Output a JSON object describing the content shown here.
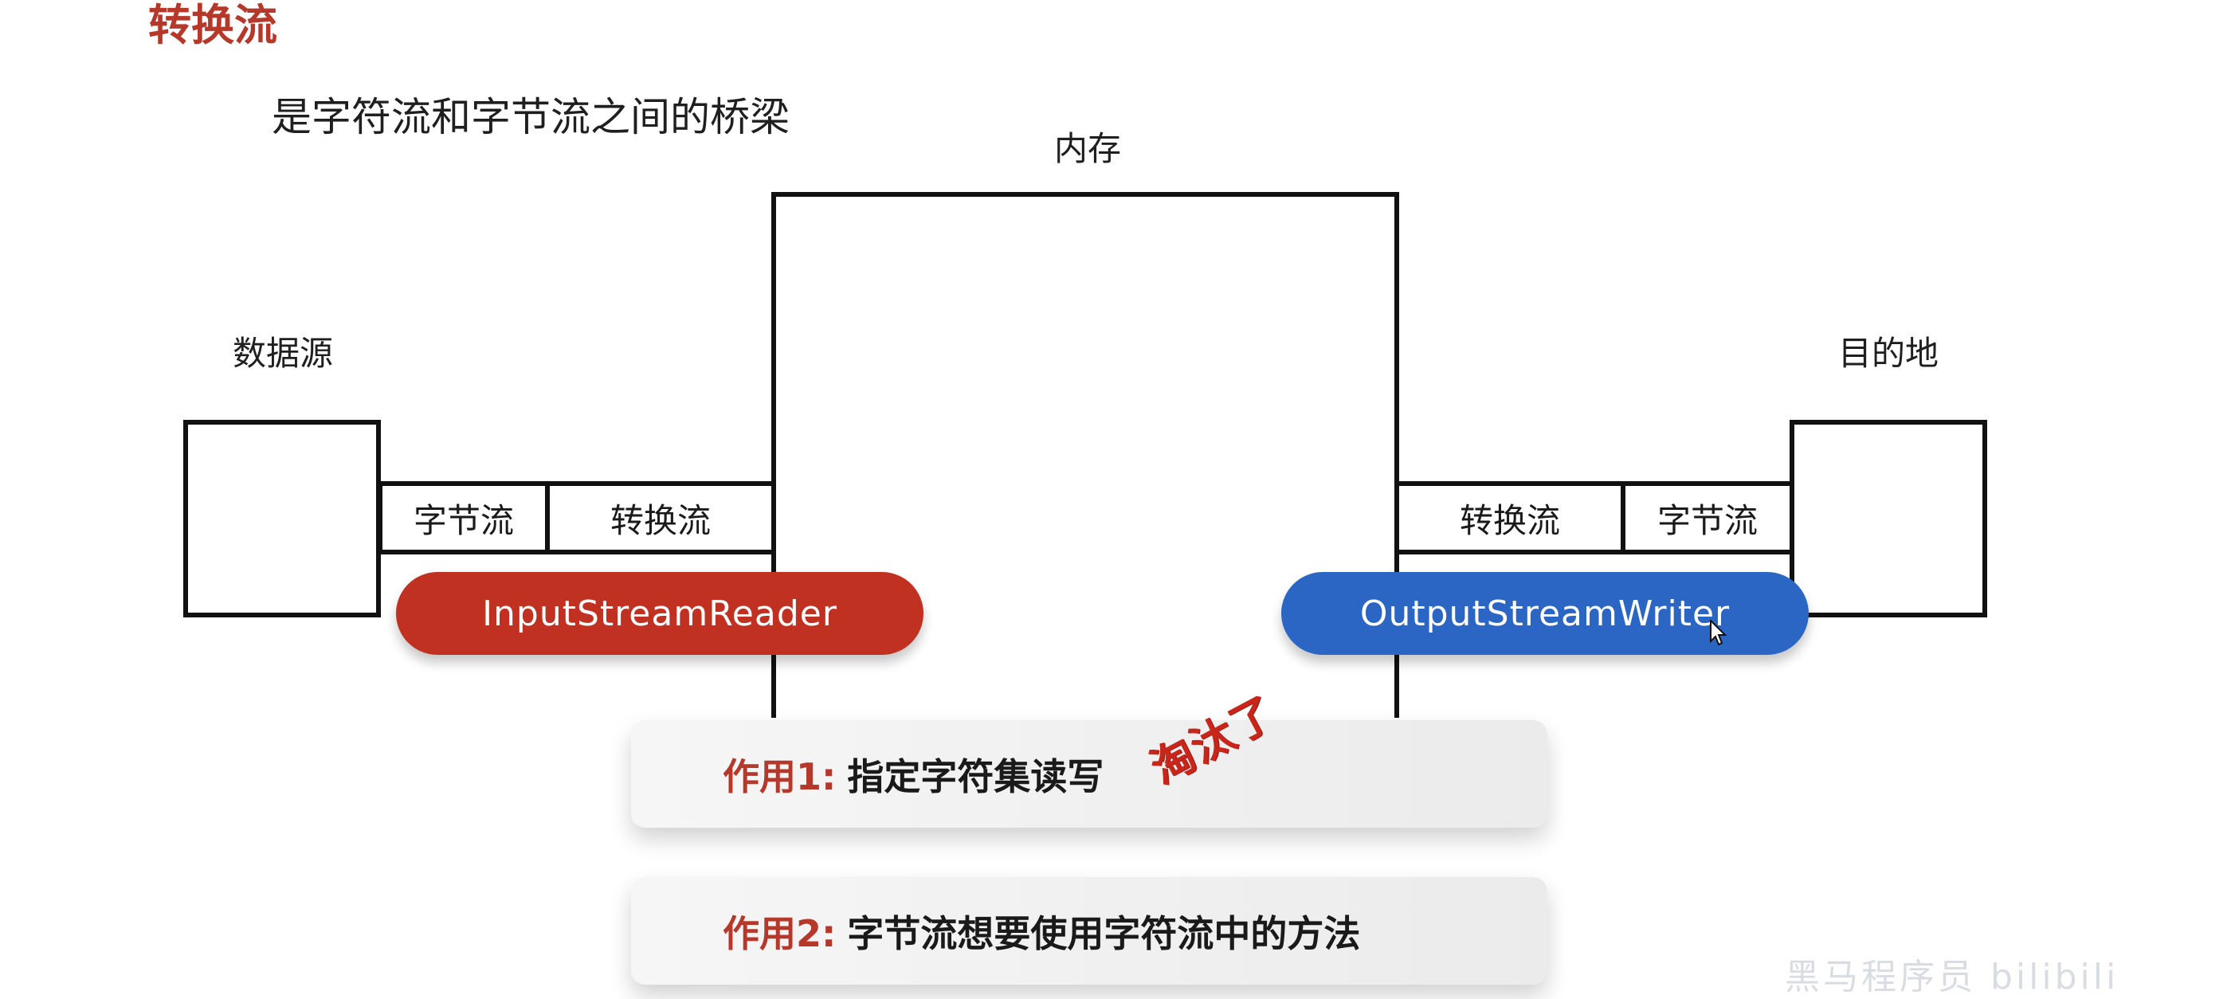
{
  "title": "转换流",
  "subtitle": "是字符流和字节流之间的桥梁",
  "labels": {
    "memory": "内存",
    "source": "数据源",
    "destination": "目的地"
  },
  "left_stream": {
    "byte_stream": "字节流",
    "convert_stream": "转换流",
    "class_name": "InputStreamReader"
  },
  "right_stream": {
    "convert_stream": "转换流",
    "byte_stream": "字节流",
    "class_name": "OutputStreamWriter"
  },
  "uses": [
    {
      "key": "作用1:",
      "text": "指定字符集读写"
    },
    {
      "key": "作用2:",
      "text": "字节流想要使用字符流中的方法"
    }
  ],
  "stamp": "淘汰了",
  "watermark": "黑马程序员 bilibili",
  "colors": {
    "title_red": "#b5382a",
    "input_pill": "#c03122",
    "output_pill": "#2c66c4",
    "stamp_red": "#c8261b"
  }
}
